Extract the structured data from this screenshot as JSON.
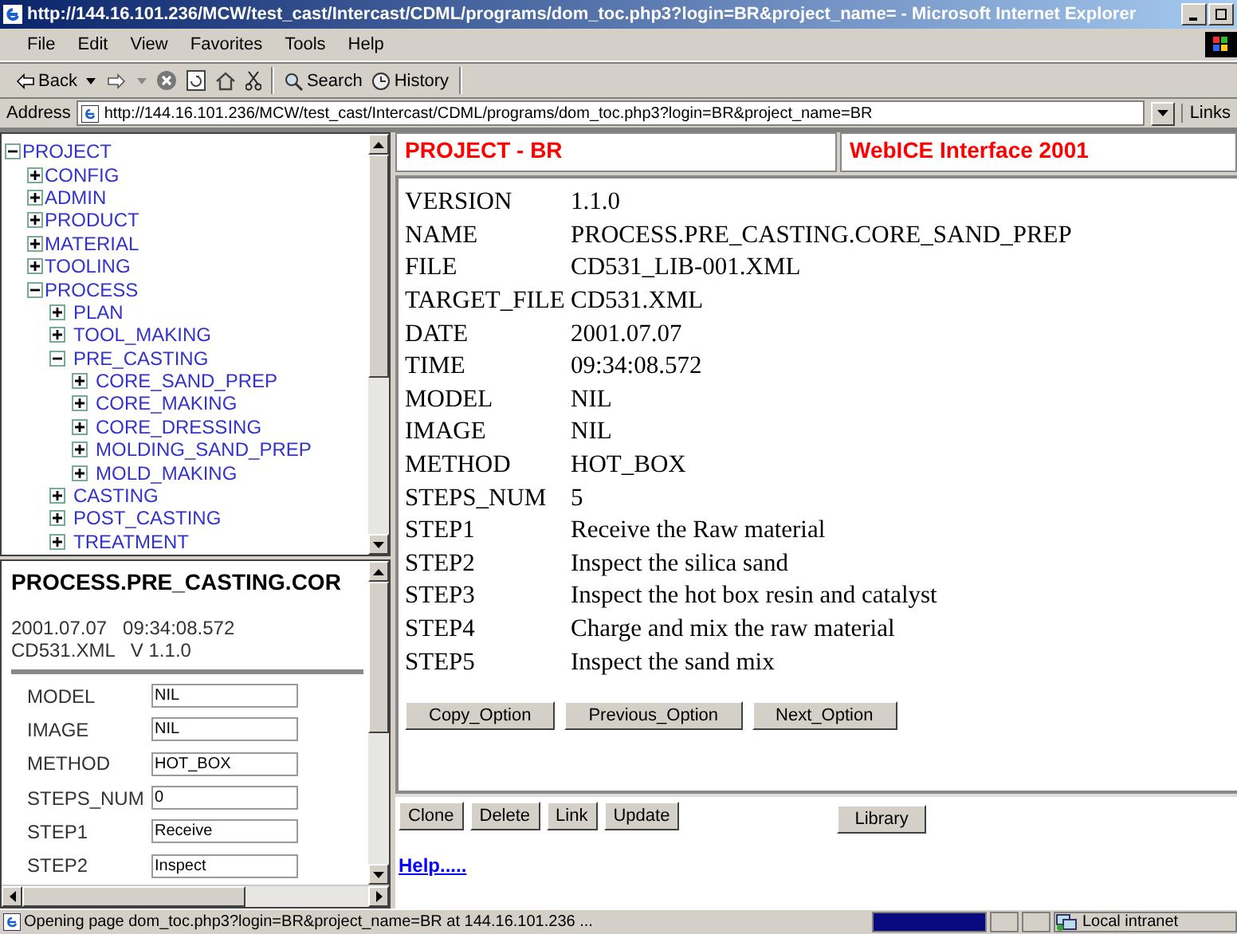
{
  "window": {
    "title": "http://144.16.101.236/MCW/test_cast/Intercast/CDML/programs/dom_toc.php3?login=BR&project_name= - Microsoft Internet Explorer"
  },
  "menu": [
    "File",
    "Edit",
    "View",
    "Favorites",
    "Tools",
    "Help"
  ],
  "toolbar": {
    "back": "Back",
    "search": "Search",
    "history": "History"
  },
  "address": {
    "label": "Address",
    "value": "http://144.16.101.236/MCW/test_cast/Intercast/CDML/programs/dom_toc.php3?login=BR&project_name=BR",
    "links": "Links"
  },
  "tree": [
    {
      "label": "PROJECT",
      "expanded": true,
      "children": [
        {
          "label": "CONFIG",
          "expanded": false
        },
        {
          "label": "ADMIN",
          "expanded": false
        },
        {
          "label": "PRODUCT",
          "expanded": false
        },
        {
          "label": "MATERIAL",
          "expanded": false
        },
        {
          "label": "TOOLING",
          "expanded": false
        },
        {
          "label": "PROCESS",
          "expanded": true,
          "children": [
            {
              "label": "PLAN",
              "expanded": false
            },
            {
              "label": "TOOL_MAKING",
              "expanded": false
            },
            {
              "label": "PRE_CASTING",
              "expanded": true,
              "children": [
                {
                  "label": "CORE_SAND_PREP",
                  "expanded": false
                },
                {
                  "label": "CORE_MAKING",
                  "expanded": false
                },
                {
                  "label": "CORE_DRESSING",
                  "expanded": false
                },
                {
                  "label": "MOLDING_SAND_PREP",
                  "expanded": false
                },
                {
                  "label": "MOLD_MAKING",
                  "expanded": false
                }
              ]
            },
            {
              "label": "CASTING",
              "expanded": false
            },
            {
              "label": "POST_CASTING",
              "expanded": false
            },
            {
              "label": "TREATMENT",
              "expanded": false
            }
          ]
        }
      ]
    }
  ],
  "form_panel": {
    "title": "PROCESS.PRE_CASTING.COR",
    "timestamp": "2001.07.07   09:34:08.572",
    "file_version": "CD531.XML   V 1.1.0",
    "fields": [
      {
        "label": "MODEL",
        "value": "NIL"
      },
      {
        "label": "IMAGE",
        "value": "NIL"
      },
      {
        "label": "METHOD",
        "value": "HOT_BOX"
      },
      {
        "label": "STEPS_NUM",
        "value": "0"
      },
      {
        "label": "STEP1",
        "value": "Receive"
      },
      {
        "label": "STEP2",
        "value": "Inspect"
      }
    ]
  },
  "header": {
    "project": "PROJECT - BR",
    "product": "WebICE Interface 2001"
  },
  "details": [
    {
      "key": "VERSION",
      "value": "1.1.0"
    },
    {
      "key": "NAME",
      "value": "PROCESS.PRE_CASTING.CORE_SAND_PREP"
    },
    {
      "key": "FILE",
      "value": "CD531_LIB-001.XML"
    },
    {
      "key": "TARGET_FILE",
      "value": "CD531.XML"
    },
    {
      "key": "DATE",
      "value": "2001.07.07"
    },
    {
      "key": "TIME",
      "value": "09:34:08.572"
    },
    {
      "key": "MODEL",
      "value": "NIL"
    },
    {
      "key": "IMAGE",
      "value": "NIL"
    },
    {
      "key": "METHOD",
      "value": "HOT_BOX"
    },
    {
      "key": "STEPS_NUM",
      "value": "5"
    },
    {
      "key": "STEP1",
      "value": "Receive the Raw material"
    },
    {
      "key": "STEP2",
      "value": "Inspect the silica sand"
    },
    {
      "key": "STEP3",
      "value": "Inspect the hot box resin and catalyst"
    },
    {
      "key": "STEP4",
      "value": "Charge and mix the raw material"
    },
    {
      "key": "STEP5",
      "value": "Inspect the sand mix"
    }
  ],
  "option_buttons": [
    "Copy_Option",
    "Previous_Option",
    "Next_Option"
  ],
  "action_buttons": [
    "Clone",
    "Delete",
    "Link",
    "Update"
  ],
  "library_button": "Library",
  "help_link": "Help.....",
  "status_bar": {
    "text": "Opening page dom_toc.php3?login=BR&project_name=BR at 144.16.101.236 ...",
    "progress": {
      "level": 1
    },
    "zone": "Local intranet"
  }
}
